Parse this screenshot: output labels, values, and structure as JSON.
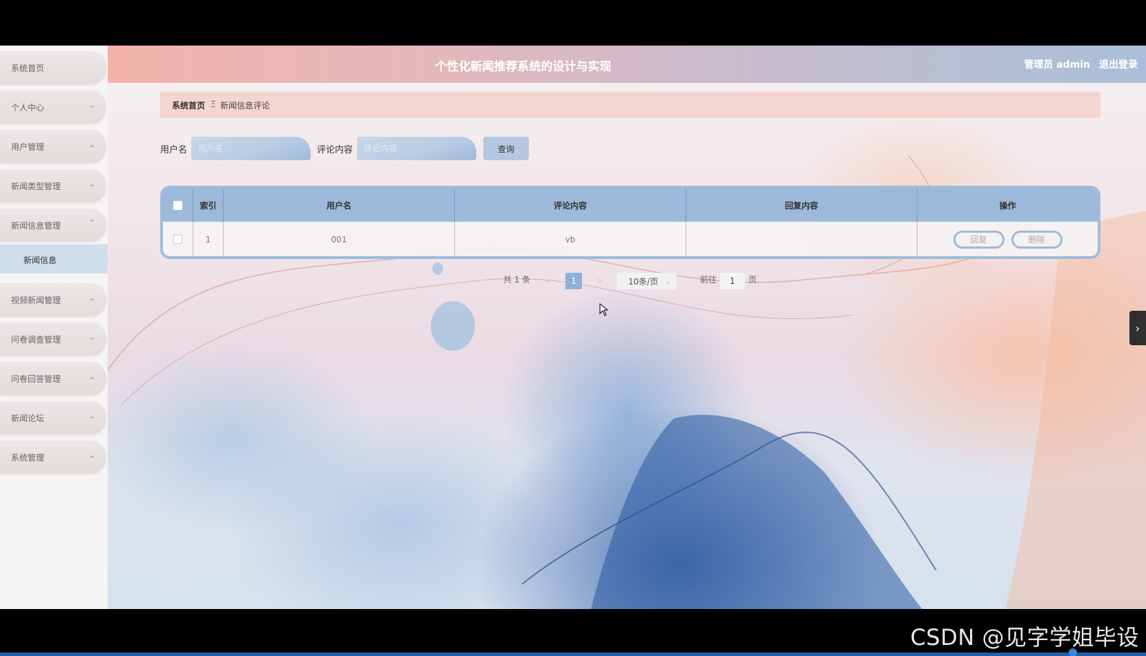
{
  "header": {
    "title": "个性化新闻推荐系统的设计与实现",
    "user": "管理员 admin",
    "logout": "退出登录"
  },
  "sidebar": {
    "items": [
      {
        "label": "系统首页"
      },
      {
        "label": "个人中心"
      },
      {
        "label": "用户管理"
      },
      {
        "label": "新闻类型管理"
      },
      {
        "label": "新闻信息管理"
      },
      {
        "label": "视频新闻管理"
      },
      {
        "label": "问卷调查管理"
      },
      {
        "label": "问卷回答管理"
      },
      {
        "label": "新闻论坛"
      },
      {
        "label": "系统管理"
      }
    ],
    "sub_item": "新闻信息"
  },
  "breadcrumb": {
    "home": "系统首页",
    "separator": "Ξ",
    "current": "新闻信息评论"
  },
  "search": {
    "username_label": "用户名",
    "username_placeholder": "用户名",
    "comment_label": "评论内容",
    "comment_placeholder": "评论内容",
    "query_button": "查询"
  },
  "table": {
    "headers": {
      "index": "索引",
      "username": "用户名",
      "comment": "评论内容",
      "reply": "回复内容",
      "ops": "操作"
    },
    "rows": [
      {
        "index": "1",
        "username": "001",
        "comment": "vb",
        "reply": "",
        "reply_btn": "回复",
        "delete_btn": "删除"
      }
    ]
  },
  "pagination": {
    "total": "共 1 条",
    "prev": "<",
    "current": "1",
    "next": ">",
    "page_size": "10条/页",
    "goto_label": "前往",
    "goto_value": "1",
    "page_unit": "页"
  },
  "watermark": "CSDN @见字学姐毕设",
  "colors": {
    "accent": "#9cb9da",
    "header_start": "#f2b4aa",
    "header_end": "#a9bfd9",
    "breadcrumb_bg": "#f5d5d2"
  }
}
